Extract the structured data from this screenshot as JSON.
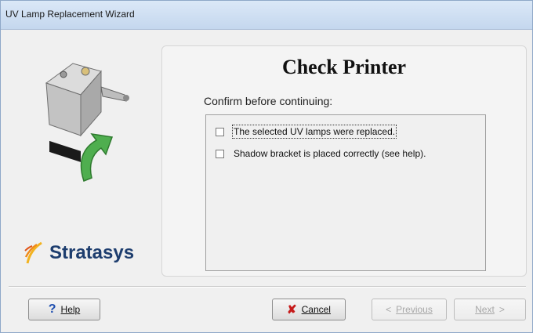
{
  "window": {
    "title": "UV Lamp Replacement Wizard"
  },
  "page": {
    "title": "Check Printer",
    "instruction": "Confirm before continuing:"
  },
  "checklist": [
    {
      "label": "The selected UV lamps were replaced.",
      "checked": false
    },
    {
      "label": "Shadow bracket is placed correctly (see help).",
      "checked": false
    }
  ],
  "branding": {
    "logo_text": "Stratasys"
  },
  "buttons": {
    "help": {
      "label": "Help",
      "icon": "question-icon"
    },
    "cancel": {
      "label": "Cancel",
      "icon": "x-icon"
    },
    "previous": {
      "label": "Previous",
      "icon": "back-arrow-icon",
      "enabled": false
    },
    "next": {
      "label": "Next",
      "icon": "forward-arrow-icon",
      "enabled": false
    }
  },
  "colors": {
    "logo": "#1d3d6e",
    "arrow": "#3a9a3a",
    "cancel_icon": "#c61b1b",
    "help_icon": "#1f4fb0"
  }
}
